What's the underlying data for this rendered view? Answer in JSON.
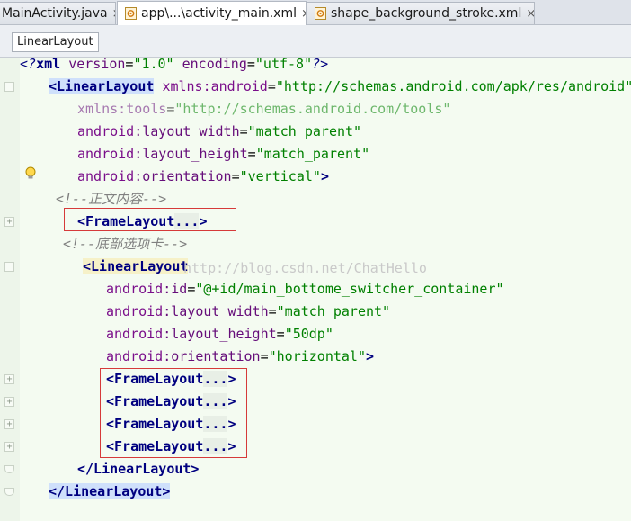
{
  "tabs": [
    {
      "label": "MainActivity.java",
      "close": "×",
      "icon": "java-file-icon"
    },
    {
      "label": "app\\...\\activity_main.xml",
      "close": "×",
      "icon": "xml-layout-icon",
      "active": true
    },
    {
      "label": "shape_background_stroke.xml",
      "close": "×",
      "icon": "xml-layout-icon"
    }
  ],
  "breadcrumb": "LinearLayout",
  "code": {
    "l1": [
      "<?",
      "xml ",
      "version",
      "=",
      "\"1.0\"",
      " ",
      "encoding",
      "=",
      "\"utf-8\"",
      "?>"
    ],
    "l2": [
      "<LinearLayout",
      " ",
      "xmlns:",
      "android",
      "=",
      "\"http://schemas.android.com/apk/res/android\""
    ],
    "l3": [
      "xmlns:",
      "tools",
      "=",
      "\"http://schemas.android.com/tools\""
    ],
    "l4": [
      "android",
      ":layout_width",
      "=",
      "\"match_parent\""
    ],
    "l5": [
      "android",
      ":layout_height",
      "=",
      "\"match_parent\""
    ],
    "l6": [
      "android",
      ":orientation",
      "=",
      "\"vertical\"",
      ">"
    ],
    "l7": "<!--正文内容-->",
    "l8": [
      "<FrameLayout",
      "...",
      ">"
    ],
    "l9": "<!--底部选项卡-->",
    "l10": "<LinearLayout",
    "l11": [
      "android",
      ":id",
      "=",
      "\"@+id/main_bottome_switcher_container\""
    ],
    "l12": [
      "android",
      ":layout_width",
      "=",
      "\"match_parent\""
    ],
    "l13": [
      "android",
      ":layout_height",
      "=",
      "\"50dp\""
    ],
    "l14": [
      "android",
      ":orientation",
      "=",
      "\"horizontal\"",
      ">"
    ],
    "frames": [
      [
        "<FrameLayout",
        "...",
        ">"
      ],
      [
        "<FrameLayout",
        "...",
        ">"
      ],
      [
        "<FrameLayout",
        "...",
        ">"
      ],
      [
        "<FrameLayout",
        "...",
        ">"
      ]
    ],
    "l19": "</LinearLayout>",
    "l20": "</LinearLayout>"
  },
  "watermark": "http://blog.csdn.net/ChatHello",
  "colors": {
    "tag": "#000080",
    "attribute": "#660e7a",
    "string": "#008000",
    "comment": "#808080",
    "highlight": "#cfe0fb",
    "annotation_box": "#d63a3a"
  }
}
